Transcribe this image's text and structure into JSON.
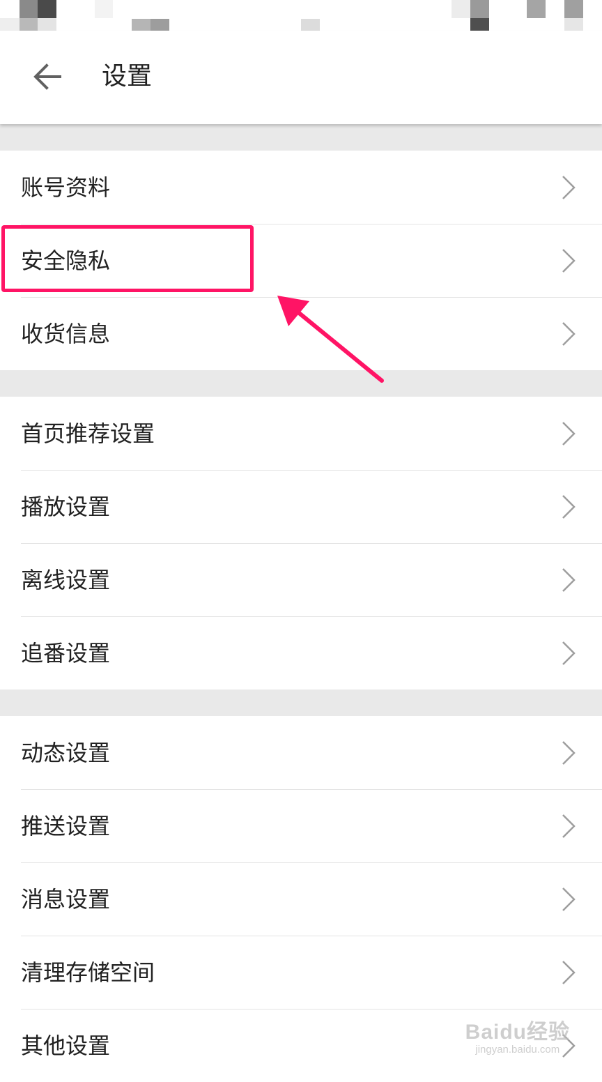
{
  "colors": {
    "accent_annotation": "#ff1465",
    "section_gap": "#e9e9e9",
    "divider": "#e3e3e3",
    "chevron": "#9e9e9e",
    "text": "#212121"
  },
  "header": {
    "title": "设置",
    "back_icon": "arrow-left-icon"
  },
  "sections": [
    {
      "items": [
        {
          "label": "账号资料",
          "icon": "chevron-right-icon"
        },
        {
          "label": "安全隐私",
          "icon": "chevron-right-icon",
          "highlighted": true
        },
        {
          "label": "收货信息",
          "icon": "chevron-right-icon"
        }
      ]
    },
    {
      "items": [
        {
          "label": "首页推荐设置",
          "icon": "chevron-right-icon"
        },
        {
          "label": "播放设置",
          "icon": "chevron-right-icon"
        },
        {
          "label": "离线设置",
          "icon": "chevron-right-icon"
        },
        {
          "label": "追番设置",
          "icon": "chevron-right-icon"
        }
      ]
    },
    {
      "items": [
        {
          "label": "动态设置",
          "icon": "chevron-right-icon"
        },
        {
          "label": "推送设置",
          "icon": "chevron-right-icon"
        },
        {
          "label": "消息设置",
          "icon": "chevron-right-icon"
        },
        {
          "label": "清理存储空间",
          "icon": "chevron-right-icon"
        },
        {
          "label": "其他设置",
          "icon": "chevron-right-icon"
        }
      ]
    }
  ],
  "watermark": {
    "main": "Baidu经验",
    "sub": "jingyan.baidu.com"
  }
}
